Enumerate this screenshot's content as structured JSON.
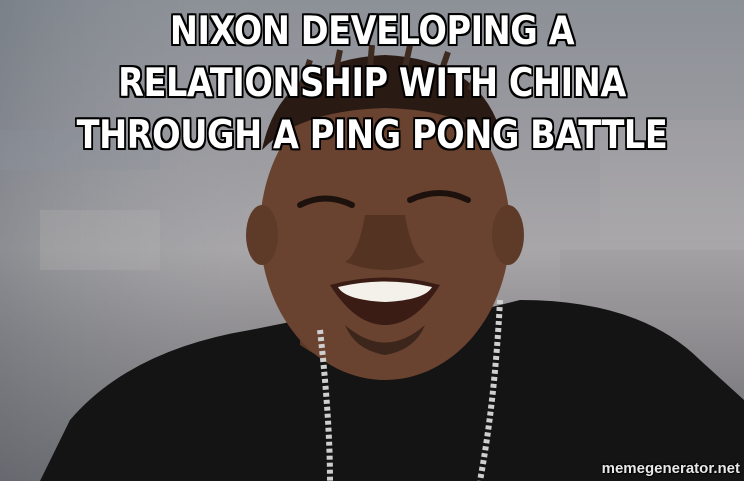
{
  "meme": {
    "caption": "NIXON DEVELOPING A RELATIONSHIP WITH CHINA THROUGH A PING PONG BATTLE",
    "watermark": "memegenerator.net"
  },
  "colors": {
    "caption_text": "#ffffff",
    "caption_outline": "#000000",
    "background": "#9a9aa0",
    "shirt": "#141414",
    "skin": "#6a4330"
  }
}
